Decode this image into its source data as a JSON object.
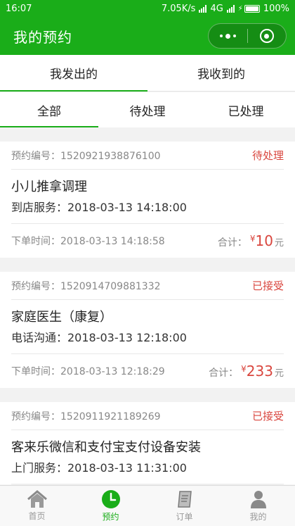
{
  "status_bar": {
    "time": "16:07",
    "speed": "7.05K/s",
    "network": "4G",
    "battery": "100%"
  },
  "header": {
    "title": "我的预约"
  },
  "main_tabs": [
    {
      "label": "我发出的",
      "active": true
    },
    {
      "label": "我收到的",
      "active": false
    }
  ],
  "sub_tabs": [
    {
      "label": "全部",
      "active": true
    },
    {
      "label": "待处理",
      "active": false
    },
    {
      "label": "已处理",
      "active": false
    }
  ],
  "orders": [
    {
      "order_no": "预约编号：1520921938876100",
      "status": "待处理",
      "service": "小儿推拿调理",
      "detail": "到店服务：2018-03-13 14:18:00",
      "order_time": "下单时间：2018-03-13 14:18:58",
      "total_label": "合计：",
      "currency": "¥",
      "amount": "10",
      "unit": "元"
    },
    {
      "order_no": "预约编号：1520914709881332",
      "status": "已接受",
      "service": "家庭医生（康复）",
      "detail": "电话沟通：2018-03-13 12:18:00",
      "order_time": "下单时间：2018-03-13 12:18:29",
      "total_label": "合计：",
      "currency": "¥",
      "amount": "233",
      "unit": "元"
    },
    {
      "order_no": "预约编号：1520911921189269",
      "status": "已接受",
      "service": "客来乐微信和支付宝支付设备安装",
      "detail": "上门服务：2018-03-13 11:31:00"
    }
  ],
  "bottom_nav": [
    {
      "label": "首页",
      "icon": "home-icon",
      "active": false
    },
    {
      "label": "预约",
      "icon": "clock-icon",
      "active": true
    },
    {
      "label": "订单",
      "icon": "order-icon",
      "active": false
    },
    {
      "label": "我的",
      "icon": "person-icon",
      "active": false
    }
  ],
  "colors": {
    "brand_green": "#1aad19",
    "status_red": "#d9463e"
  }
}
